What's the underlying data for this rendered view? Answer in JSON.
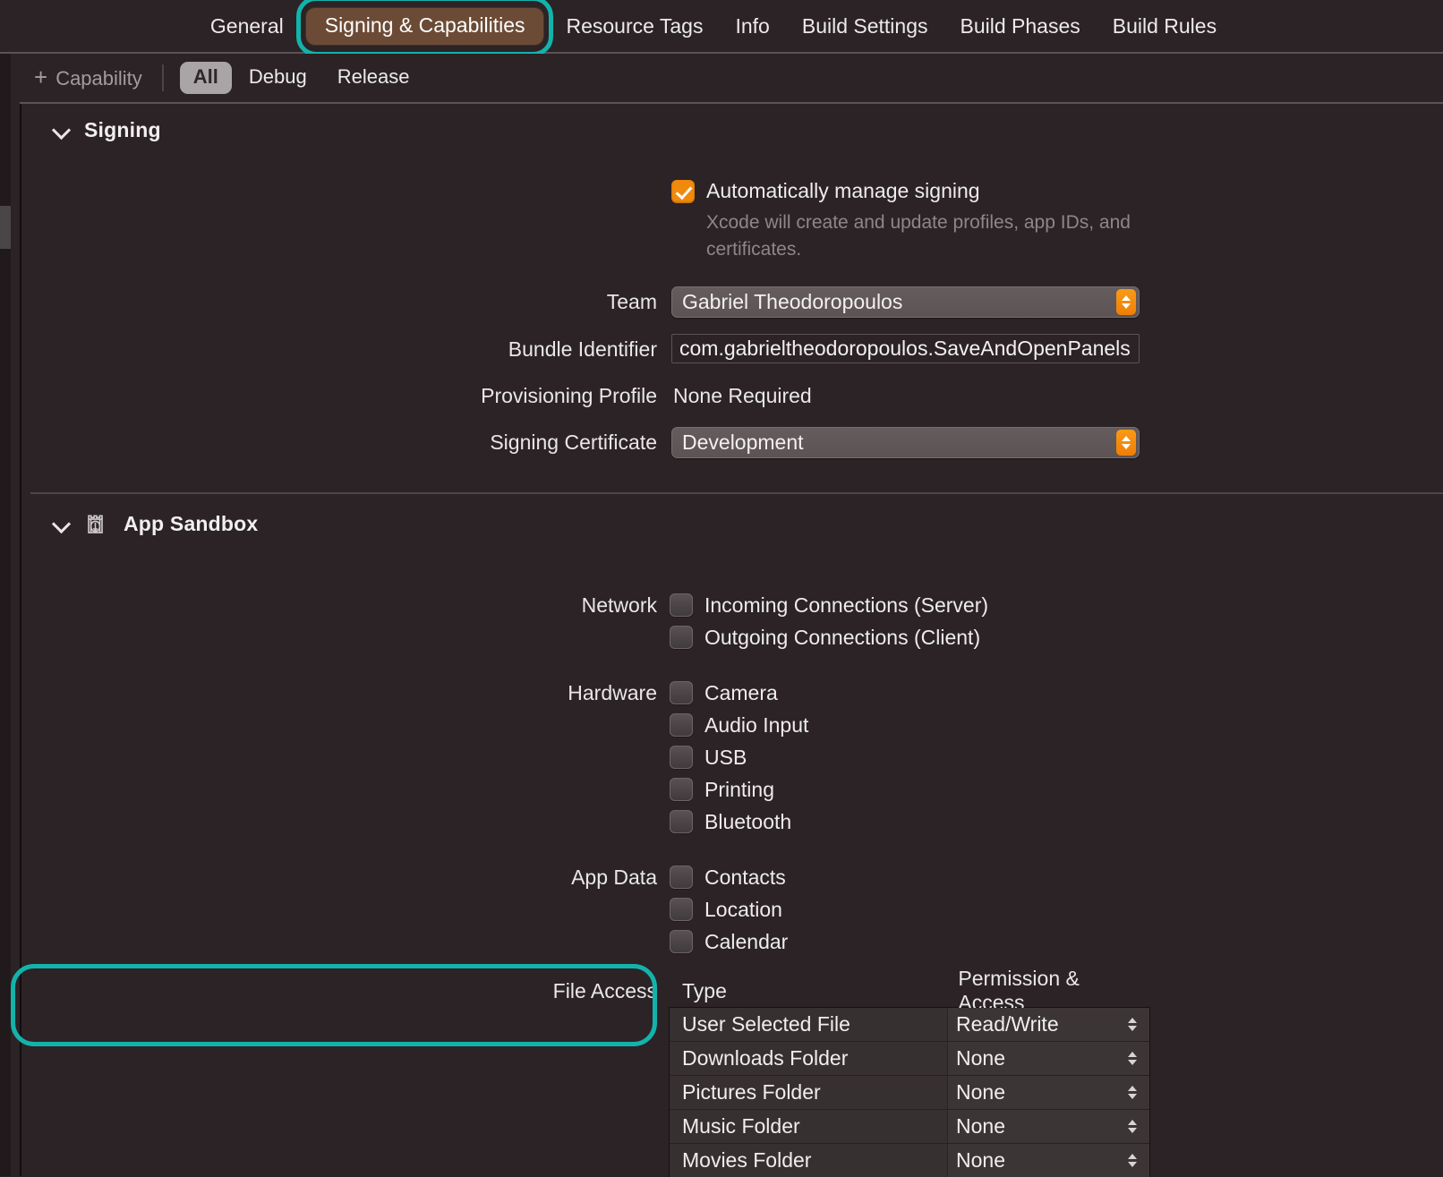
{
  "tabs": [
    {
      "label": "General",
      "selected": false
    },
    {
      "label": "Signing & Capabilities",
      "selected": true
    },
    {
      "label": "Resource Tags",
      "selected": false
    },
    {
      "label": "Info",
      "selected": false
    },
    {
      "label": "Build Settings",
      "selected": false
    },
    {
      "label": "Build Phases",
      "selected": false
    },
    {
      "label": "Build Rules",
      "selected": false
    }
  ],
  "toolbar": {
    "add_capability_label": "Capability",
    "add_capability_plus": "+",
    "segments": [
      {
        "label": "All",
        "active": true
      },
      {
        "label": "Debug",
        "active": false
      },
      {
        "label": "Release",
        "active": false
      }
    ]
  },
  "signing": {
    "title": "Signing",
    "auto_manage": {
      "label": "Automatically manage signing",
      "checked": true,
      "description": "Xcode will create and update profiles, app IDs, and certificates."
    },
    "fields": [
      {
        "label": "Team",
        "value": "Gabriel Theodoropoulos",
        "kind": "popup"
      },
      {
        "label": "Bundle Identifier",
        "value": "com.gabrieltheodoropoulos.SaveAndOpenPanels",
        "kind": "text"
      },
      {
        "label": "Provisioning Profile",
        "value": "None Required",
        "kind": "plain"
      },
      {
        "label": "Signing Certificate",
        "value": "Development",
        "kind": "popup"
      }
    ]
  },
  "app_sandbox": {
    "title": "App Sandbox",
    "icon": "sandbox-castle-icon",
    "groups": [
      {
        "label": "Network",
        "items": [
          {
            "label": "Incoming Connections (Server)",
            "checked": false
          },
          {
            "label": "Outgoing Connections (Client)",
            "checked": false
          }
        ]
      },
      {
        "label": "Hardware",
        "items": [
          {
            "label": "Camera",
            "checked": false
          },
          {
            "label": "Audio Input",
            "checked": false
          },
          {
            "label": "USB",
            "checked": false
          },
          {
            "label": "Printing",
            "checked": false
          },
          {
            "label": "Bluetooth",
            "checked": false
          }
        ]
      },
      {
        "label": "App Data",
        "items": [
          {
            "label": "Contacts",
            "checked": false
          },
          {
            "label": "Location",
            "checked": false
          },
          {
            "label": "Calendar",
            "checked": false
          }
        ]
      }
    ],
    "file_access": {
      "label": "File Access",
      "columns": {
        "type": "Type",
        "permission": "Permission & Access"
      },
      "rows": [
        {
          "type": "User Selected File",
          "permission": "Read/Write"
        },
        {
          "type": "Downloads Folder",
          "permission": "None"
        },
        {
          "type": "Pictures Folder",
          "permission": "None"
        },
        {
          "type": "Music Folder",
          "permission": "None"
        },
        {
          "type": "Movies Folder",
          "permission": "None"
        }
      ]
    }
  },
  "colors": {
    "background": "#2b2326",
    "highlight_ring": "#13b3ab",
    "selected_tab": "#6c4b36",
    "checkbox_on": "#f18a0c",
    "stepper_orange": "#f2860a"
  }
}
